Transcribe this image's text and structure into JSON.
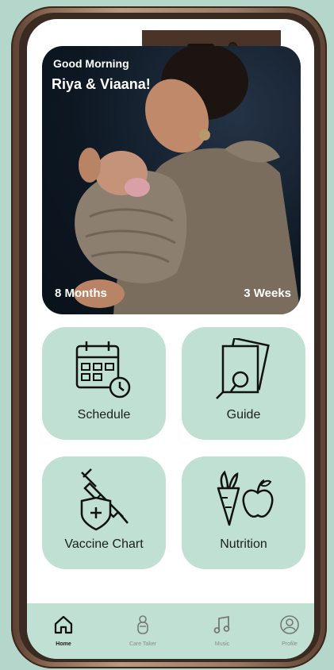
{
  "hero": {
    "greeting": "Good Morning",
    "names": "Riya & Viaana!",
    "left_stat": "8 Months",
    "right_stat": "3 Weeks"
  },
  "tiles": [
    {
      "label": "Schedule",
      "icon": "calendar-clock-icon"
    },
    {
      "label": "Guide",
      "icon": "guide-book-icon"
    },
    {
      "label": "Vaccine Chart",
      "icon": "syringe-shield-icon"
    },
    {
      "label": "Nutrition",
      "icon": "carrot-apple-icon"
    }
  ],
  "tabs": [
    {
      "label": "Home",
      "icon": "home-icon",
      "active": true
    },
    {
      "label": "Care Taker",
      "icon": "baby-icon",
      "active": false
    },
    {
      "label": "Music",
      "icon": "music-note-icon",
      "active": false
    },
    {
      "label": "Profile",
      "icon": "profile-icon",
      "active": false
    }
  ],
  "colors": {
    "background": "#b5d6cb",
    "tile": "#bfe0d3",
    "tabbar": "#bfe0d3",
    "frame": "#8a6a54"
  }
}
